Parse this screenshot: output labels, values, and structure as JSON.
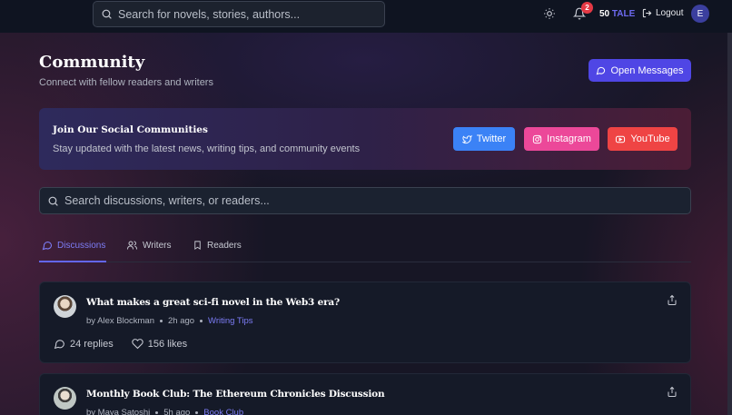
{
  "topbar": {
    "search_placeholder": "Search for novels, stories, authors...",
    "notification_count": "2",
    "token_amount": "50",
    "token_unit": "TALE",
    "logout_label": "Logout",
    "avatar_initial": "E"
  },
  "header": {
    "title": "Community",
    "subtitle": "Connect with fellow readers and writers",
    "open_messages_label": "Open Messages"
  },
  "social": {
    "title": "Join Our Social Communities",
    "subtitle": "Stay updated with the latest news, writing tips, and community events",
    "buttons": [
      {
        "label": "Twitter",
        "icon": "twitter-icon",
        "color": "#3b82f6"
      },
      {
        "label": "Instagram",
        "icon": "instagram-icon",
        "color": "#ec4899"
      },
      {
        "label": "YouTube",
        "icon": "youtube-icon",
        "color": "#ef4444"
      }
    ]
  },
  "search": {
    "placeholder": "Search discussions, writers, or readers..."
  },
  "tabs": [
    {
      "label": "Discussions",
      "icon": "chat-bubble-icon",
      "active": true
    },
    {
      "label": "Writers",
      "icon": "users-icon",
      "active": false
    },
    {
      "label": "Readers",
      "icon": "bookmark-icon",
      "active": false
    }
  ],
  "posts": [
    {
      "title": "What makes a great sci-fi novel in the Web3 era?",
      "author": "by Alex Blockman",
      "time": "2h ago",
      "tag": "Writing Tips",
      "replies": "24 replies",
      "likes": "156 likes"
    },
    {
      "title": "Monthly Book Club: The Ethereum Chronicles Discussion",
      "author": "by Maya Satoshi",
      "time": "5h ago",
      "tag": "Book Club"
    }
  ],
  "colors": {
    "accent": "#6366f1",
    "background": "#171625",
    "badge": "#e53945"
  }
}
